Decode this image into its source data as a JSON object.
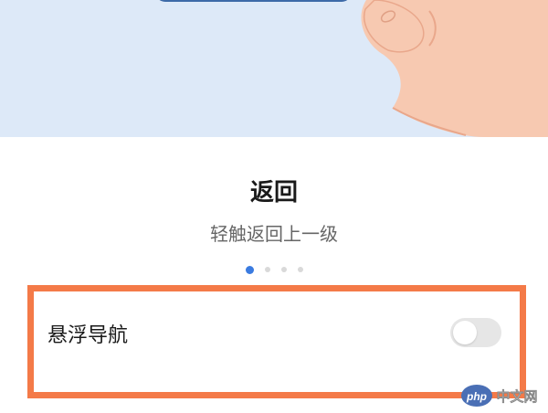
{
  "illustration": {
    "alt": "hand tapping illustration"
  },
  "gesture_page": {
    "title": "返回",
    "subtitle": "轻触返回上一级",
    "pager": {
      "total": 4,
      "active_index": 0
    }
  },
  "setting": {
    "label": "悬浮导航",
    "toggle_on": false
  },
  "colors": {
    "accent": "#3a7be0",
    "highlight_border": "#f47a48",
    "illustration_bg": "#dde9f8"
  }
}
